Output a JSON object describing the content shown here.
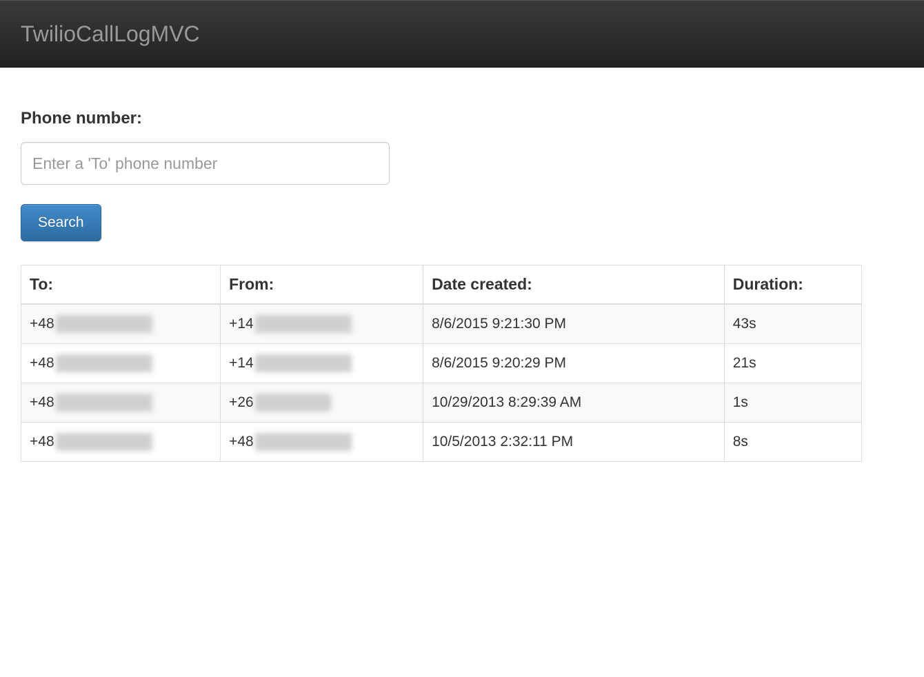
{
  "navbar": {
    "brand": "TwilioCallLogMVC"
  },
  "form": {
    "label": "Phone number:",
    "placeholder": "Enter a 'To' phone number",
    "value": "",
    "search_button": "Search"
  },
  "table": {
    "headers": {
      "to": "To:",
      "from": "From:",
      "date_created": "Date created:",
      "duration": "Duration:"
    },
    "rows": [
      {
        "to_prefix": "+48",
        "to_redacted_width": 140,
        "from_prefix": "+14",
        "from_redacted_width": 140,
        "date_created": "8/6/2015 9:21:30 PM",
        "duration": "43s"
      },
      {
        "to_prefix": "+48",
        "to_redacted_width": 140,
        "from_prefix": "+14",
        "from_redacted_width": 140,
        "date_created": "8/6/2015 9:20:29 PM",
        "duration": "21s"
      },
      {
        "to_prefix": "+48",
        "to_redacted_width": 140,
        "from_prefix": "+26",
        "from_redacted_width": 110,
        "date_created": "10/29/2013 8:29:39 AM",
        "duration": "1s"
      },
      {
        "to_prefix": "+48",
        "to_redacted_width": 140,
        "from_prefix": "+48",
        "from_redacted_width": 140,
        "date_created": "10/5/2013 2:32:11 PM",
        "duration": "8s"
      }
    ]
  }
}
